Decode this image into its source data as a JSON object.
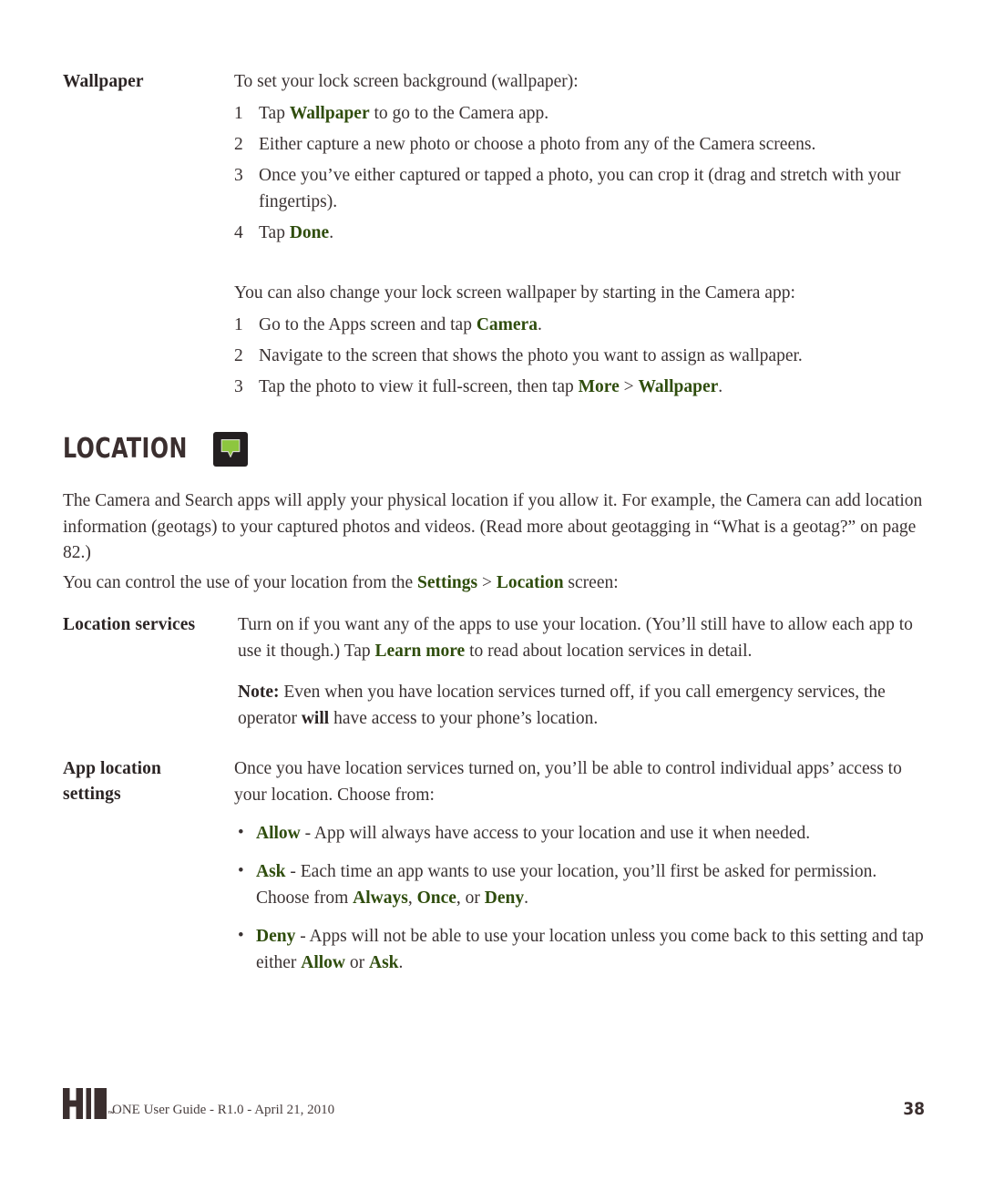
{
  "page": {
    "number": "38"
  },
  "wallpaper_section": {
    "label": "Wallpaper",
    "intro": "To set your lock screen background (wallpaper):",
    "steps": [
      {
        "num": "1",
        "pre": "Tap ",
        "em": "Wallpaper",
        "post": " to go to the Camera app."
      },
      {
        "num": "2",
        "pre": "Either capture a new photo or choose a photo from any of the Camera screens.",
        "em": "",
        "post": ""
      },
      {
        "num": "3",
        "pre": "Once you’ve either captured or tapped a photo, you can crop it (drag and stretch with your fingertips).",
        "em": "",
        "post": ""
      },
      {
        "num": "4",
        "pre": "Tap ",
        "em": "Done",
        "post": "."
      }
    ],
    "intro2": "You can also change your lock screen wallpaper by starting in the Camera app:",
    "steps2": [
      {
        "num": "1",
        "pre": "Go to the Apps screen and tap ",
        "em": "Camera",
        "post": "."
      },
      {
        "num": "2",
        "pre": "Navigate to the screen that shows the photo you want to assign as wallpaper.",
        "em": "",
        "post": ""
      },
      {
        "num": "3",
        "pre": "Tap the photo to view it full-screen, then tap ",
        "em": "More",
        "mid": " > ",
        "em2": "Wallpaper",
        "post": "."
      }
    ]
  },
  "location_section": {
    "heading": "LOCATION",
    "heading_icon": "location-pin-icon",
    "icon_bg_color": "#231f20",
    "icon_pin_color": "#8dc63f",
    "paragraph1": "The Camera and Search apps will apply your physical location if you allow it. For example, the Camera can add location information (geotags) to your captured photos and videos. (Read more about geotagging in “What is a geotag?” on page 82.)",
    "paragraph2_pre": "You can control the use of your location from the ",
    "paragraph2_em1": "Settings",
    "paragraph2_mid": " > ",
    "paragraph2_em2": "Location",
    "paragraph2_post": " screen:"
  },
  "location_services": {
    "label": "Location services",
    "body_pre": "Turn on if you want any of the apps to use your location. (You’ll still have to allow each app to use it though.) Tap ",
    "body_em": "Learn more",
    "body_post": " to read about location services in detail.",
    "note_label": "Note:",
    "note_pre": " Even when you have location services turned off, if you call emergency services, the operator ",
    "note_em": "will",
    "note_post": " have access to your phone’s location."
  },
  "app_location_settings": {
    "label_line1": "App location",
    "label_line2": "settings",
    "intro": "Once you have location services turned on, you’ll be able to control individual apps’ access to your location. Choose from:",
    "bullet_glyph": "•",
    "bullets": [
      {
        "em": "Allow",
        "text": " - App will always have access to your location and use it when needed."
      },
      {
        "em": "Ask",
        "text": " - Each time an app wants to use your location, you’ll first be asked for permission. Choose from ",
        "em_a": "Always",
        "sep_a": ", ",
        "em_b": "Once",
        "sep_b": ", or ",
        "em_c": "Deny",
        "tail": "."
      },
      {
        "em": "Deny",
        "text": " - Apps will not be able to use your location unless you come back to this setting and tap either ",
        "em_a": "Allow",
        "sep_a": " or ",
        "em_b": "Ask",
        "tail": "."
      }
    ]
  },
  "footer": {
    "logo": "kin-logo",
    "trademark": "™",
    "text": "ONE User Guide - R1.0 - April 21, 2010",
    "page_number": "38"
  },
  "colors": {
    "emphasis_green": "#2f4d0d",
    "body_text": "#3a3232",
    "heading": "#3b2f2f",
    "icon_green": "#8dc63f",
    "icon_dark": "#231f20"
  }
}
